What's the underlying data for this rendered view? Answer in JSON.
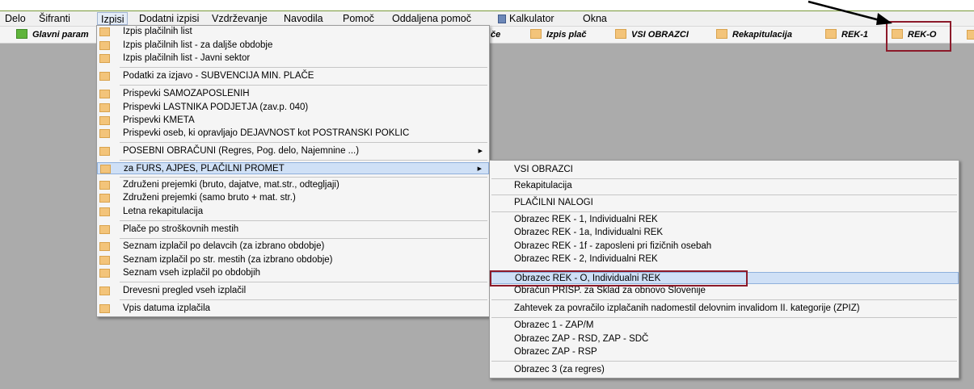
{
  "menubar": [
    {
      "label": "Delo"
    },
    {
      "label": "Šifranti"
    },
    {
      "label": "Izpisi"
    },
    {
      "label": "Dodatni izpisi"
    },
    {
      "label": "Vzdrževanje"
    },
    {
      "label": "Navodila"
    },
    {
      "label": "Pomoč"
    },
    {
      "label": "Oddaljena pomoč"
    },
    {
      "label": "Kalkulator",
      "icon": "calculator-icon"
    },
    {
      "label": "Okna"
    }
  ],
  "toolbar": [
    {
      "label": "Glavni param",
      "icon": "green-square-icon"
    },
    {
      "label": "če"
    },
    {
      "label": "Izpis plač",
      "icon": "folder-icon"
    },
    {
      "label": "VSI OBRAZCI",
      "icon": "folder-icon"
    },
    {
      "label": "Rekapitulacija",
      "icon": "folder-icon"
    },
    {
      "label": "REK-1",
      "icon": "folder-icon"
    },
    {
      "label": "REK-O",
      "icon": "folder-icon"
    }
  ],
  "izpisi_menu": [
    {
      "label": "Izpis plačilnih list"
    },
    {
      "label": "Izpis plačilnih list - za daljše obdobje"
    },
    {
      "label": "Izpis plačilnih list - Javni sektor"
    },
    {
      "label": "Podatki za izjavo - SUBVENCIJA MIN. PLAČE"
    },
    {
      "label": "Prispevki SAMOZAPOSLENIH"
    },
    {
      "label": "Prispevki LASTNIKA PODJETJA  (zav.p.  040)"
    },
    {
      "label": "Prispevki KMETA"
    },
    {
      "label": "Prispevki oseb, ki opravljajo DEJAVNOST kot POSTRANSKI POKLIC"
    },
    {
      "label": "POSEBNI OBRAČUNI   (Regres, Pog. delo, Najemnine ...)",
      "submenu": true
    },
    {
      "label": "za FURS, AJPES, PLAČILNI PROMET",
      "submenu": true,
      "selected": true
    },
    {
      "label": "Združeni prejemki  (bruto, dajatve, mat.str., odtegljaji)"
    },
    {
      "label": "Združeni prejemki  (samo bruto + mat. str.)"
    },
    {
      "label": "Letna rekapitulacija"
    },
    {
      "label": "Plače po stroškovnih mestih"
    },
    {
      "label": "Seznam izplačil po delavcih   (za izbrano obdobje)"
    },
    {
      "label": "Seznam izplačil po str. mestih   (za izbrano obdobje)"
    },
    {
      "label": "Seznam vseh izplačil po obdobjih"
    },
    {
      "label": "Drevesni pregled vseh izplačil"
    },
    {
      "label": "Vpis datuma izplačila"
    }
  ],
  "furs_submenu": [
    {
      "label": "VSI OBRAZCI"
    },
    {
      "label": "Rekapitulacija"
    },
    {
      "label": "PLAČILNI NALOGI"
    },
    {
      "label": "Obrazec REK - 1, Individualni REK"
    },
    {
      "label": "Obrazec REK - 1a, Individualni REK"
    },
    {
      "label": "Obrazec REK - 1f - zaposleni pri fizičnih osebah"
    },
    {
      "label": "Obrazec REK - 2, Individualni REK"
    },
    {
      "label": "Obrazec REK - O, Individualni REK",
      "selected": true
    },
    {
      "label": "Obračun PRISP. za Sklad za obnovo Slovenije"
    },
    {
      "label": "Zahtevek za povračilo izplačanih nadomestil delovnim invalidom II. kategorije  (ZPIZ)"
    },
    {
      "label": "Obrazec 1 - ZAP/M"
    },
    {
      "label": "Obrazec ZAP - RSD, ZAP - SDČ"
    },
    {
      "label": "Obrazec ZAP - RSP"
    },
    {
      "label": "Obrazec 3  (za regres)"
    }
  ],
  "colors": {
    "workspace": "#ababab",
    "highlight": "#cfe0f6",
    "callout_box": "#8c1a2a",
    "folder_icon": "#f3c47a"
  }
}
